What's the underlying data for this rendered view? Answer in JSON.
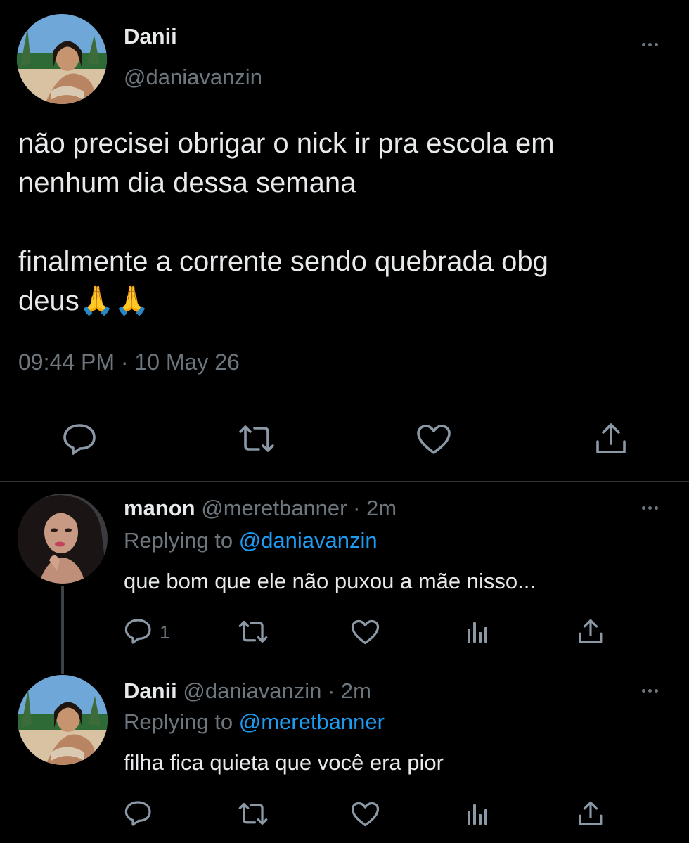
{
  "main_tweet": {
    "display_name": "Danii",
    "handle": "@daniavanzin",
    "text_line1": "não precisei obrigar o nick ir pra escola em",
    "text_line2": "nenhum dia dessa semana",
    "text_line3": "finalmente a corrente sendo quebrada obg",
    "text_line4": "deus🙏🙏",
    "timestamp": "09:44 PM · 10 May 26"
  },
  "reply1": {
    "display_name": "manon",
    "handle_time": "@meretbanner · 2m",
    "replying_prefix": "Replying to ",
    "replying_handle": "@daniavanzin",
    "text": "que bom que ele não puxou a mãe nisso...",
    "reply_count": "1"
  },
  "reply2": {
    "display_name": "Danii",
    "handle_time": "@daniavanzin · 2m",
    "replying_prefix": "Replying to ",
    "replying_handle": "@meretbanner",
    "text": "filha fica quieta que você era pior"
  },
  "colors": {
    "background": "#000000",
    "text": "#e7e9ea",
    "secondary": "#6e767d",
    "accent": "#1d9bf0",
    "divider": "#2f3336"
  }
}
